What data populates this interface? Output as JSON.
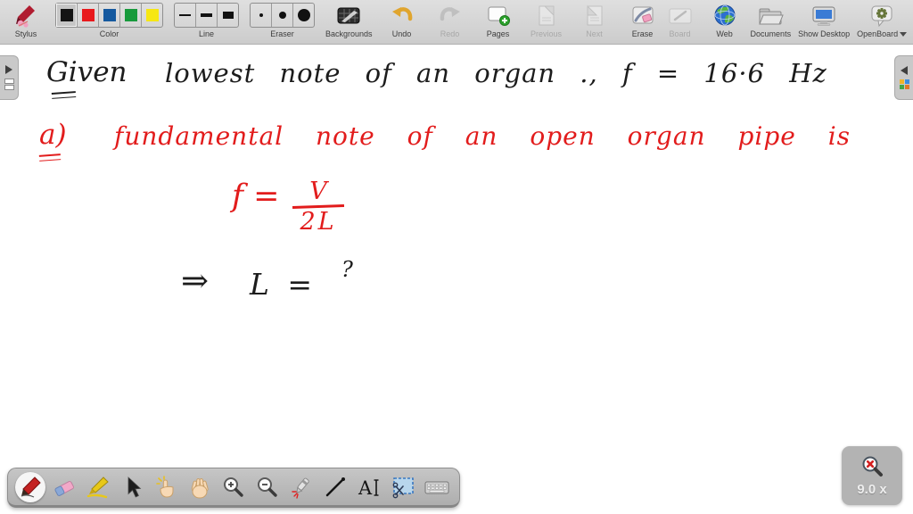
{
  "app": {
    "name": "OpenBoard"
  },
  "top_toolbar": {
    "stylus": {
      "label": "Stylus"
    },
    "color_group": {
      "label": "Color",
      "swatches": [
        {
          "name": "black",
          "hex": "#141414",
          "selected": true
        },
        {
          "name": "red",
          "hex": "#e8191c",
          "selected": false
        },
        {
          "name": "blue",
          "hex": "#15599f",
          "selected": false
        },
        {
          "name": "green",
          "hex": "#189a3c",
          "selected": false
        },
        {
          "name": "yellow",
          "hex": "#f6e713",
          "selected": false
        }
      ]
    },
    "line_group": {
      "label": "Line",
      "options": [
        "thin",
        "medium",
        "thick"
      ],
      "selected": "thin"
    },
    "eraser_group": {
      "label": "Eraser",
      "options": [
        "small",
        "medium",
        "large"
      ],
      "selected": "small"
    },
    "buttons": [
      {
        "label": "Backgrounds",
        "enabled": true
      },
      {
        "label": "Undo",
        "enabled": true
      },
      {
        "label": "Redo",
        "enabled": false
      },
      {
        "label": "Pages",
        "enabled": true
      },
      {
        "label": "Previous",
        "enabled": false
      },
      {
        "label": "Next",
        "enabled": false
      },
      {
        "label": "Erase",
        "enabled": true
      }
    ],
    "right_buttons": [
      {
        "label": "Board",
        "enabled": false
      },
      {
        "label": "Web",
        "enabled": true
      },
      {
        "label": "Documents",
        "enabled": true
      },
      {
        "label": "Show Desktop",
        "enabled": true
      },
      {
        "label": "OpenBoard",
        "enabled": true
      }
    ]
  },
  "canvas": {
    "ink_color_black": "#1c1c1c",
    "ink_color_red": "#e21c1c",
    "ink": [
      {
        "text": "Given",
        "color": "#1c1c1c"
      },
      {
        "text": "lowest note of an organ ., f = 16·6 Hz",
        "color": "#1c1c1c"
      },
      {
        "text": "a)",
        "color": "#e21c1c"
      },
      {
        "text": "fundamental note of an open organ pipe is",
        "color": "#e21c1c"
      },
      {
        "text": "f =",
        "color": "#e21c1c"
      },
      {
        "text": "V",
        "color": "#e21c1c"
      },
      {
        "text": "2L",
        "color": "#e21c1c"
      },
      {
        "text": "⇒",
        "color": "#1c1c1c"
      },
      {
        "text": "L =",
        "color": "#1c1c1c"
      },
      {
        "text": "?",
        "color": "#1c1c1c"
      }
    ]
  },
  "bottom_toolbar": {
    "selected": "pen",
    "tools": [
      "pen",
      "eraser",
      "highlighter",
      "selector",
      "interact-finger",
      "pan-hand",
      "zoom-in",
      "zoom-out",
      "laser-pointer",
      "line",
      "text",
      "capture-area",
      "virtual-keyboard"
    ]
  },
  "zoom_indicator": {
    "value": "9.0 x"
  }
}
